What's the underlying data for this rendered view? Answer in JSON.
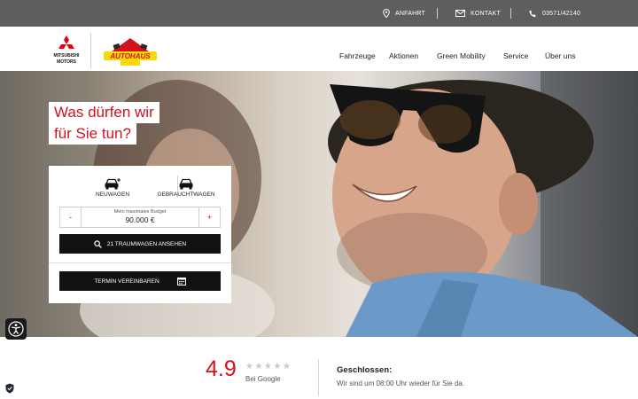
{
  "topbar": {
    "anfahrt_label": "ANFAHRT",
    "kontakt_label": "KONTAKT",
    "phone": "03571/42140"
  },
  "header": {
    "brand_lines": [
      "MITSUBISHI",
      "MOTORS"
    ],
    "dealer_logo_text": "AUTOHAUS",
    "nav": [
      "Fahrzeuge",
      "Aktionen",
      "Green Mobility",
      "Service",
      "Über uns"
    ]
  },
  "hero": {
    "headline_lines": [
      "Was dürfen wir",
      "für Sie tun?"
    ]
  },
  "search_card": {
    "tab_new": "NEUWAGEN",
    "tab_used": "GEBRAUCHTWAGEN",
    "budget_label": "Mein maximales Budget",
    "budget_value": "90.000 €",
    "minus": "-",
    "plus": "+",
    "search_button": "21 TRAUMWAGEN ANSEHEN",
    "appointment_button": "TERMIN VEREINBAREN"
  },
  "footer": {
    "rating": "4.9",
    "stars": "★★★★★",
    "rating_source": "Bei Google",
    "status_title": "Geschlossen:",
    "status_text": "Wir sind um 08:00 Uhr wieder für Sie da."
  },
  "colors": {
    "accent": "#d4121e",
    "topbar": "#5e5e5e",
    "button": "#111111"
  },
  "icons": [
    "map-pin-icon",
    "mail-icon",
    "phone-icon",
    "car-new-icon",
    "car-icon",
    "search-icon",
    "calendar-icon",
    "accessibility-icon",
    "shield-icon"
  ]
}
